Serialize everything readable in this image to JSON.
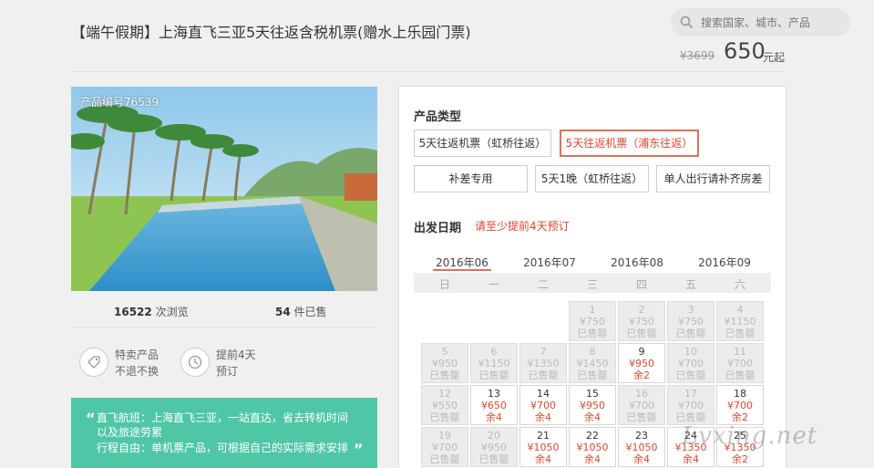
{
  "product": {
    "title": "【端午假期】上海直飞三亚5天往返含税机票(赠水上乐园门票)",
    "product_id": "产品编号76539",
    "old_price": "¥3699",
    "price": "650",
    "price_unit": "元起"
  },
  "search": {
    "placeholder": "搜索国家、城市、产品",
    "icon": "search-icon"
  },
  "stats": {
    "views_num": "16522",
    "views_label": "次浏览",
    "sold_num": "54",
    "sold_label": "件已售"
  },
  "features": [
    {
      "icon": "tag-icon",
      "line1": "特卖产品",
      "line2": "不退不换"
    },
    {
      "icon": "clock-icon",
      "line1": "提前4天",
      "line2": "预订"
    }
  ],
  "description": {
    "line1": "直飞航班：上海直飞三亚，一站直达，省去转机时间",
    "line2": "以及旅途劳累",
    "line3": "行程自由：单机票产品，可根据自己的实际需求安排"
  },
  "booking": {
    "type_label": "产品类型",
    "options": [
      "5天往返机票（虹桥往返）",
      "5天往返机票（浦东往返）",
      "补差专用",
      "5天1晚（虹桥往返）",
      "单人出行请补齐房差"
    ],
    "date_label": "出发日期",
    "date_hint": "请至少提前4天预订",
    "months": [
      "2016年06",
      "2016年07",
      "2016年08",
      "2016年09"
    ],
    "weekdays": [
      "日",
      "一",
      "二",
      "三",
      "四",
      "五",
      "六"
    ]
  },
  "calendar": [
    {
      "d": "1",
      "p": "¥750",
      "s": "已售罄"
    },
    {
      "d": "2",
      "p": "¥750",
      "s": "已售罄"
    },
    {
      "d": "3",
      "p": "¥750",
      "s": "已售罄"
    },
    {
      "d": "4",
      "p": "¥1150",
      "s": "已售罄"
    },
    {
      "d": "5",
      "p": "¥950",
      "s": "已售罄"
    },
    {
      "d": "6",
      "p": "¥1150",
      "s": "已售罄"
    },
    {
      "d": "7",
      "p": "¥1350",
      "s": "已售罄"
    },
    {
      "d": "8",
      "p": "¥1450",
      "s": "已售罄"
    },
    {
      "d": "9",
      "p": "¥950",
      "s": "余2"
    },
    {
      "d": "10",
      "p": "¥700",
      "s": "已售罄"
    },
    {
      "d": "11",
      "p": "¥700",
      "s": "已售罄"
    },
    {
      "d": "12",
      "p": "¥550",
      "s": "已售罄"
    },
    {
      "d": "13",
      "p": "¥650",
      "s": "余4"
    },
    {
      "d": "14",
      "p": "¥700",
      "s": "余4"
    },
    {
      "d": "15",
      "p": "¥950",
      "s": "余4"
    },
    {
      "d": "16",
      "p": "¥700",
      "s": "已售罄"
    },
    {
      "d": "17",
      "p": "¥700",
      "s": "已售罄"
    },
    {
      "d": "18",
      "p": "¥700",
      "s": "余2"
    },
    {
      "d": "19",
      "p": "¥700",
      "s": "已售罄"
    },
    {
      "d": "20",
      "p": "¥950",
      "s": "已售罄"
    },
    {
      "d": "21",
      "p": "¥1050",
      "s": "余4"
    },
    {
      "d": "22",
      "p": "¥1050",
      "s": "余4"
    },
    {
      "d": "23",
      "p": "¥1050",
      "s": "余4"
    },
    {
      "d": "24",
      "p": "¥1350",
      "s": "余4"
    },
    {
      "d": "25",
      "p": "¥1350",
      "s": "余2"
    }
  ],
  "watermark": "Lvxing.net",
  "colors": {
    "accent": "#e0462c",
    "green": "#4fc7a6"
  }
}
